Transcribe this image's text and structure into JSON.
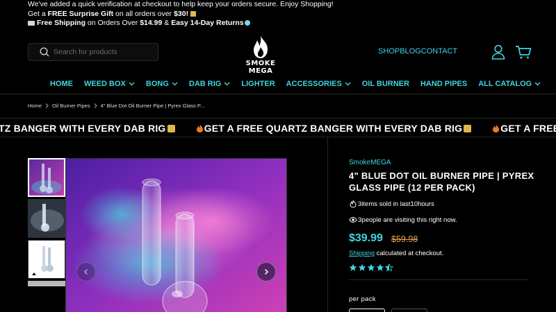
{
  "announcement": {
    "line1": "We've added a quick verification at checkout to help keep your orders secure. Enjoy Shopping!",
    "line2_prefix": "Get a ",
    "line2_bold": "FREE Surprise Gift",
    "line2_mid": " on all orders over ",
    "line2_amount": "$30!",
    "line3_bold1": "Free Shipping",
    "line3_mid": " on Orders Over ",
    "line3_amount": "$14.99",
    "line3_amp": " & ",
    "line3_bold2": "Easy 14-Day Returns"
  },
  "header": {
    "search_placeholder": "Search for products",
    "logo_text": "SMOKE MEGA",
    "links": [
      "SHOP",
      "BLOG",
      "CONTACT"
    ]
  },
  "nav": [
    {
      "label": "HOME",
      "dropdown": false
    },
    {
      "label": "WEED BOX",
      "dropdown": true
    },
    {
      "label": "BONG",
      "dropdown": true
    },
    {
      "label": "DAB RIG",
      "dropdown": true
    },
    {
      "label": "LIGHTER",
      "dropdown": false
    },
    {
      "label": "ACCESSORIES",
      "dropdown": true
    },
    {
      "label": "OIL BURNER",
      "dropdown": false
    },
    {
      "label": "HAND PIPES",
      "dropdown": false
    },
    {
      "label": "ALL CATALOG",
      "dropdown": true
    }
  ],
  "breadcrumb": [
    "Home",
    "Oil Burner Pipes",
    "4\" Blue Dot Oil Burner Pipe | Pyrex Glass P..."
  ],
  "marquee": {
    "segments": [
      "QUARTZ BANGER WITH EVERY DAB RIG",
      "GET A FREE QUARTZ BANGER WITH EVERY DAB RIG",
      "GET A FREE QUARTZ"
    ]
  },
  "product": {
    "vendor": "SmokeMEGA",
    "title": "4\" BLUE DOT OIL BURNER PIPE | PYREX GLASS PIPE (12 PER PACK)",
    "sold_count": "3",
    "sold_text": "items sold in last",
    "sold_hours": "10",
    "sold_unit": "hours",
    "visiting_count": "3",
    "visiting_text": "people are visiting this right now.",
    "price": "$39.99",
    "compare_price": "$59.98",
    "shipping_link": "Shipping",
    "shipping_rest": " calculated at checkout.",
    "rating": 4.5,
    "option_label": "per pack"
  },
  "colors": {
    "accent": "#3fd6e0",
    "compare": "#e8a04a",
    "background": "#000000"
  }
}
